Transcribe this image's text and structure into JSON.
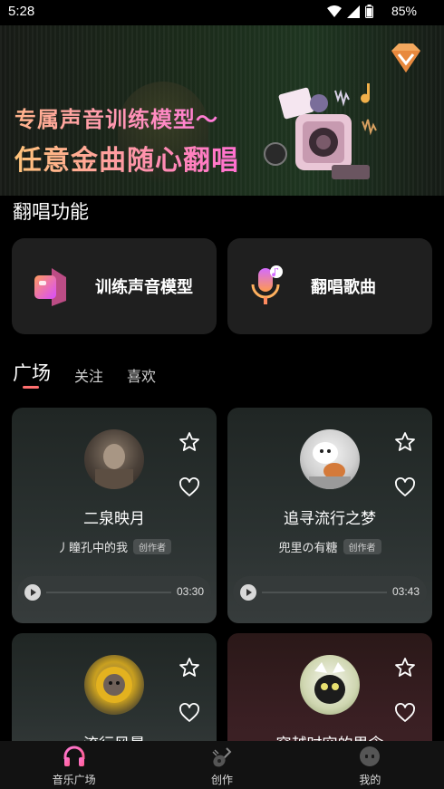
{
  "status_bar": {
    "time": "5:28",
    "battery": "85%"
  },
  "banner": {
    "line1": "专属声音训练模型～",
    "line2": "任意金曲随心翻唱"
  },
  "section_title": "翻唱功能",
  "features": [
    {
      "label": "训练声音模型"
    },
    {
      "label": "翻唱歌曲"
    }
  ],
  "tabs": [
    {
      "label": "广场",
      "active": true
    },
    {
      "label": "关注"
    },
    {
      "label": "喜欢"
    }
  ],
  "creator_badge": "创作者",
  "songs": [
    {
      "title": "二泉映月",
      "author": "丿瞳孔中的我",
      "duration": "03:30"
    },
    {
      "title": "追寻流行之梦",
      "author": "兜里の有糖",
      "duration": "03:43"
    },
    {
      "title": "流行风暴"
    },
    {
      "title": "穿越时空的思念"
    }
  ],
  "bottom_nav": [
    {
      "label": "音乐广场",
      "icon": "headphones-icon"
    },
    {
      "label": "创作",
      "icon": "guitar-icon"
    },
    {
      "label": "我的",
      "icon": "profile-icon"
    }
  ],
  "colors": {
    "accent": "#ff6f6f",
    "background": "#000000",
    "card": "#1f1f1f"
  }
}
